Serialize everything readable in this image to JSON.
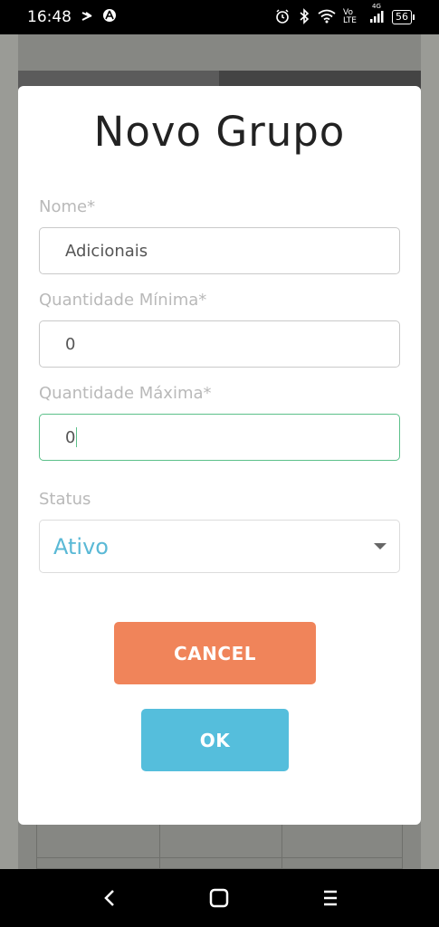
{
  "status_bar": {
    "time": "16:48",
    "network": "Vo LTE",
    "network_type": "4G",
    "battery": "56"
  },
  "modal": {
    "title": "Novo Grupo",
    "fields": {
      "nome": {
        "label": "Nome*",
        "value": "Adicionais"
      },
      "qtd_min": {
        "label": "Quantidade Mínima*",
        "value": "0"
      },
      "qtd_max": {
        "label": "Quantidade Máxima*",
        "value": "0"
      },
      "status": {
        "label": "Status",
        "value": "Ativo"
      }
    },
    "buttons": {
      "cancel": "CANCEL",
      "ok": "OK"
    }
  },
  "colors": {
    "cancel_button": "#f0845a",
    "ok_button": "#55bedc",
    "focus_border": "#5cc08a",
    "select_text": "#5ab9d6"
  },
  "icons": {
    "status_left": [
      "screen-record-icon",
      "app-notification-icon"
    ],
    "status_right": [
      "alarm-icon",
      "bluetooth-icon",
      "wifi-icon",
      "signal-icon",
      "battery-icon"
    ],
    "nav": [
      "back-icon",
      "home-icon",
      "recents-icon"
    ]
  }
}
